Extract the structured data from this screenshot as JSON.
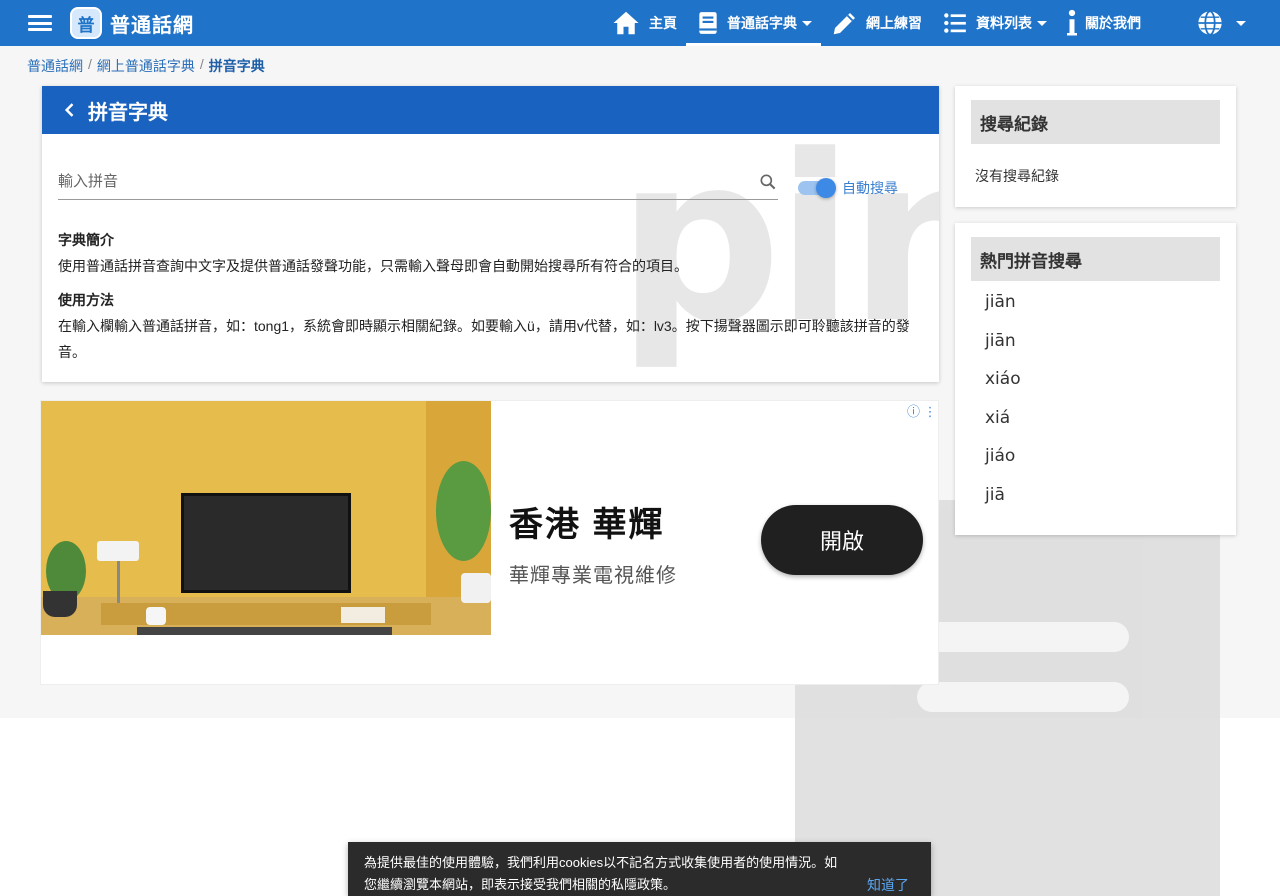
{
  "app": {
    "logo_glyph": "普",
    "logo_text": "普通話網"
  },
  "nav": {
    "items": [
      {
        "label": "主頁",
        "icon": "home-icon"
      },
      {
        "label": "普通話字典",
        "icon": "book-icon",
        "active": true,
        "dropdown": true
      },
      {
        "label": "網上練習",
        "icon": "pencil-icon"
      },
      {
        "label": "資料列表",
        "icon": "list-icon",
        "dropdown": true
      },
      {
        "label": "關於我們",
        "icon": "info-icon"
      }
    ],
    "language_icon": "globe-icon"
  },
  "breadcrumb": {
    "items": [
      "普通話網",
      "網上普通話字典",
      "拼音字典"
    ],
    "separator": "/"
  },
  "main": {
    "title": "拼音字典",
    "watermark": "pin",
    "search": {
      "placeholder": "輸入拼音",
      "value": ""
    },
    "auto_search": {
      "label": "自動搜尋",
      "enabled": true
    },
    "intro": {
      "heading": "字典簡介",
      "text": "使用普通話拼音查詢中文字及提供普通話發聲功能，只需輸入聲母即會自動開始搜尋所有符合的項目。"
    },
    "usage": {
      "heading": "使用方法",
      "text": "在輸入欄輸入普通話拼音，如：tong1，系統會即時顯示相關紀錄。如要輸入ü，請用v代替，如：lv3。按下揚聲器圖示即可聆聽該拼音的發音。"
    }
  },
  "ad": {
    "title": "香港 華輝",
    "subtitle": "華輝專業電視維修",
    "button": "開啟",
    "info_icon": "ⓘ ⋮"
  },
  "sidebar": {
    "history": {
      "title": "搜尋紀錄",
      "empty_text": "沒有搜尋紀錄"
    },
    "popular": {
      "title": "熱門拼音搜尋",
      "items": [
        "jiān",
        "jiān",
        "xiáo",
        "xiá",
        "jiáo",
        "jiā"
      ]
    }
  },
  "cookie": {
    "text": "為提供最佳的使用體驗，我們利用cookies以不記名方式收集使用者的使用情況。如您繼續瀏覽本網站，即表示接受我們相關的私隱政策。",
    "accept": "知道了"
  },
  "colors": {
    "topbar": "#1f73c8",
    "card_header": "#1a62bf",
    "link": "#2a6fb8",
    "toggle": "#3d8ae6"
  }
}
